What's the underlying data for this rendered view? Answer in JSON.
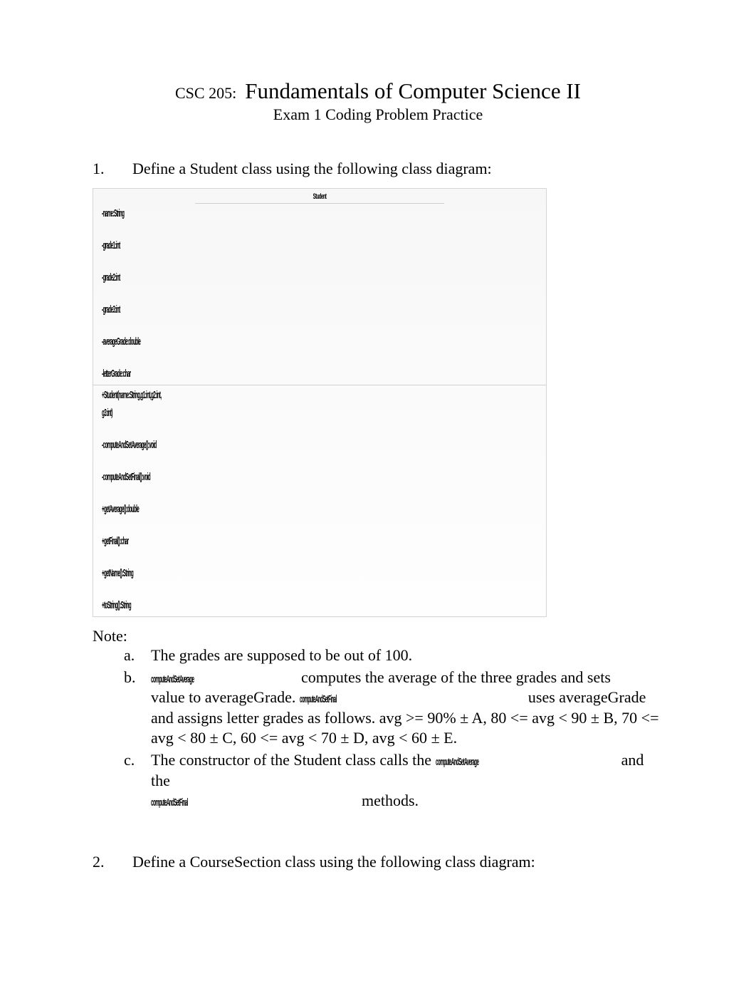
{
  "header": {
    "course_code": "CSC 205:",
    "course_title": "Fundamentals of Computer Science II",
    "subtitle": "Exam 1 Coding Problem Practice"
  },
  "q1": {
    "num": "1.",
    "text": "Define a Student class using the following class diagram:"
  },
  "uml": {
    "class_name": "Student",
    "attributes": [
      "-name:String",
      "-grade1:int",
      "-grade2:int",
      "-grade3:int",
      "-averageGrade:double",
      "-letterGrade:char"
    ],
    "constructor_line1": "+Student(name:String,g1:int,g2:int,",
    "constructor_line2": "g3:int)",
    "methods": [
      "-computeAndSetAverage():void",
      "-computeAndSetFinal():void",
      "+getAverage():double",
      "+getFinal():char",
      "+getName():String",
      "+toString():String"
    ]
  },
  "notes": {
    "label": "Note:",
    "a": {
      "letter": "a.",
      "text": "The grades are supposed to be out of 100."
    },
    "b": {
      "letter": "b.",
      "code1": "computeAndSetAverage",
      "part1": "computes the average of the three grades and sets",
      "part2": "value to averageGrade.",
      "code2": "computeAndSetFinal",
      "part3": "uses averageGrade",
      "part4a": "and assigns letter grades as follows. avg >= 90% ",
      "sym1": "±",
      "part4b": "  A, 80 <= avg < 90 ",
      "sym2": "±",
      "part4c": " B, 70 <=",
      "part5a": "avg < 80 ",
      "sym3": "±",
      "part5b": " C, 60 <= avg < 70 ",
      "sym4": "±",
      "part5c": " D, avg < 60 ",
      "sym5": "±",
      "part5d": " E."
    },
    "c": {
      "letter": "c.",
      "part1": "The constructor of the Student class calls the ",
      "code1": "computeAndSetAverage",
      "part2": "and the",
      "code2": "computeAndSetFinal",
      "part3": "methods."
    }
  },
  "q2": {
    "num": "2.",
    "text": "Define a CourseSection class using the following class diagram:"
  }
}
